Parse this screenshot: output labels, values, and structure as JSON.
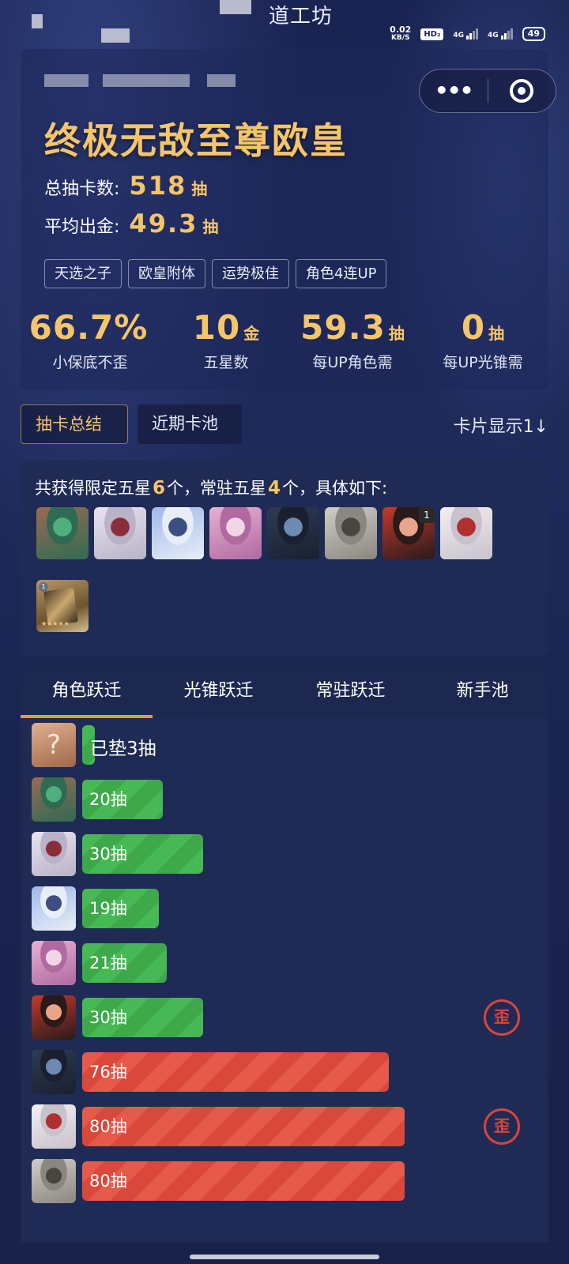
{
  "status_bar": {
    "app_title": "道工坊",
    "net_speed_value": "0.02",
    "net_speed_unit": "KB/S",
    "hd_label": "HD₂",
    "signal1_label": "4G",
    "signal2_label": "4G",
    "battery": "49"
  },
  "capsule": {
    "more_icon": "more-icon",
    "close_icon": "target-icon"
  },
  "summary_header": {
    "title": "终极无敌至尊欧皇",
    "total_pulls_label": "总抽卡数:",
    "total_pulls_value": "518",
    "total_pulls_unit": "抽",
    "avg_gold_label": "平均出金:",
    "avg_gold_value": "49.3",
    "avg_gold_unit": "抽",
    "tags": [
      "天选之子",
      "欧皇附体",
      "运势极佳",
      "角色4连UP"
    ]
  },
  "metrics": [
    {
      "value": "66.7%",
      "unit": "",
      "label": "小保底不歪"
    },
    {
      "value": "10",
      "unit": "金",
      "label": "五星数"
    },
    {
      "value": "59.3",
      "unit": "抽",
      "label": "每UP角色需"
    },
    {
      "value": "0",
      "unit": "抽",
      "label": "每UP光锥需"
    }
  ],
  "segment_tabs": {
    "active": "抽卡总结",
    "other": "近期卡池"
  },
  "card_toggle": "卡片显示1↓",
  "obtained": {
    "prefix": "共获得限定五星",
    "limited_count": "6",
    "middle": "个，常驻五星",
    "standard_count": "4",
    "suffix": "个，具体如下:",
    "avatars": [
      {
        "name": "avatar-1",
        "colors": [
          "#9a6a55",
          "#2f6b52",
          "#4fb07e"
        ]
      },
      {
        "name": "avatar-2",
        "colors": [
          "#e8e4ee",
          "#b9b2c9",
          "#8c2e3a"
        ]
      },
      {
        "name": "avatar-3",
        "colors": [
          "#9fb8e8",
          "#e8eef8",
          "#3d4f82"
        ]
      },
      {
        "name": "avatar-4",
        "colors": [
          "#e7b0d4",
          "#b06aa0",
          "#f0d6e6"
        ]
      },
      {
        "name": "avatar-5",
        "colors": [
          "#2e3b52",
          "#1a2030",
          "#6d8bb0"
        ]
      },
      {
        "name": "avatar-6",
        "colors": [
          "#d0ccc8",
          "#8a8680",
          "#4a4440"
        ]
      },
      {
        "name": "avatar-7",
        "colors": [
          "#c23a2e",
          "#2a1a1a",
          "#e8a58a"
        ],
        "badge": "1"
      },
      {
        "name": "avatar-8",
        "colors": [
          "#f2f0f2",
          "#c8c2cc",
          "#b03030"
        ]
      }
    ],
    "lightcone_stars": "★★★★★",
    "lightcone_badge": "1"
  },
  "warp_tabs": [
    "角色跃迁",
    "光锥跃迁",
    "常驻跃迁",
    "新手池"
  ],
  "warp_rows": [
    {
      "type": "pity",
      "label": "已垫3抽",
      "pulls": 3,
      "avatar": [
        "#c98a6a",
        "#a06848",
        "#e0b090"
      ],
      "q": "?"
    },
    {
      "type": "green",
      "label": "20抽",
      "pulls": 20,
      "avatar": [
        "#9a6a55",
        "#2f6b52",
        "#4fb07e"
      ]
    },
    {
      "type": "green",
      "label": "30抽",
      "pulls": 30,
      "avatar": [
        "#e8e4ee",
        "#b9b2c9",
        "#8c2e3a"
      ]
    },
    {
      "type": "green",
      "label": "19抽",
      "pulls": 19,
      "avatar": [
        "#9fb8e8",
        "#e8eef8",
        "#3d4f82"
      ]
    },
    {
      "type": "green",
      "label": "21抽",
      "pulls": 21,
      "avatar": [
        "#e7b0d4",
        "#b06aa0",
        "#f0d6e6"
      ]
    },
    {
      "type": "green",
      "label": "30抽",
      "pulls": 30,
      "avatar": [
        "#c23a2e",
        "#2a1a1a",
        "#e8a58a"
      ],
      "stamp": "歪"
    },
    {
      "type": "red",
      "label": "76抽",
      "pulls": 76,
      "avatar": [
        "#2e3b52",
        "#1a2030",
        "#6d8bb0"
      ]
    },
    {
      "type": "red",
      "label": "80抽",
      "pulls": 80,
      "avatar": [
        "#f2f0f2",
        "#c8c2cc",
        "#b03030"
      ],
      "stamp": "歪"
    },
    {
      "type": "red",
      "label": "80抽",
      "pulls": 80,
      "avatar": [
        "#d0ccc8",
        "#8a8680",
        "#4a4440"
      ]
    }
  ],
  "colors": {
    "gold": "#f6c56a",
    "green": "#46b954",
    "red": "#e65a4b",
    "tab_underline": "#d8a437"
  }
}
